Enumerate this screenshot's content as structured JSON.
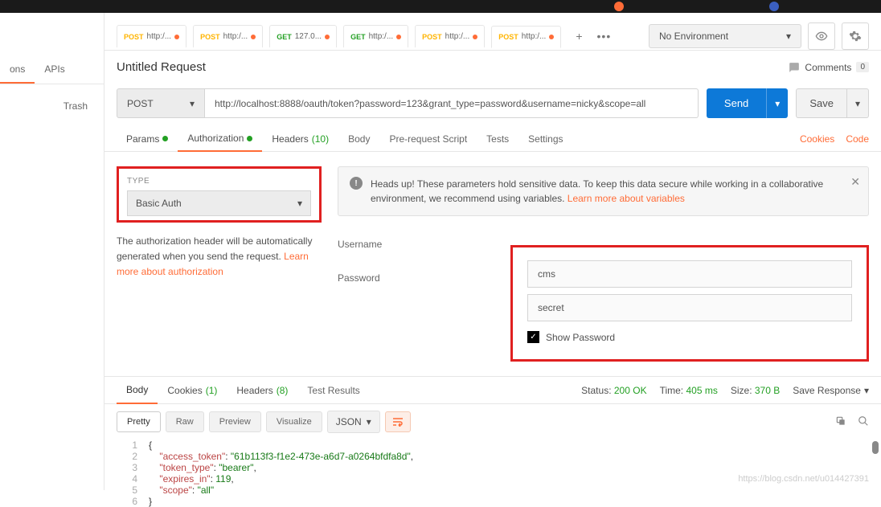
{
  "sidebar": {
    "tab1": "ons",
    "tab2": "APIs",
    "trash": "Trash"
  },
  "tabs": [
    {
      "method": "POST",
      "url": "http:/..."
    },
    {
      "method": "POST",
      "url": "http:/..."
    },
    {
      "method": "GET",
      "url": "127.0..."
    },
    {
      "method": "GET",
      "url": "http:/..."
    },
    {
      "method": "POST",
      "url": "http:/..."
    },
    {
      "method": "POST",
      "url": "http:/..."
    }
  ],
  "env": {
    "label": "No Environment"
  },
  "request": {
    "title": "Untitled Request",
    "comments": "Comments",
    "comments_count": "0",
    "method": "POST",
    "url": "http://localhost:8888/oauth/token?password=123&grant_type=password&username=nicky&scope=all",
    "send": "Send",
    "save": "Save"
  },
  "reqtabs": {
    "params": "Params",
    "auth": "Authorization",
    "headers": "Headers",
    "headers_cnt": "(10)",
    "body": "Body",
    "prereq": "Pre-request Script",
    "tests": "Tests",
    "settings": "Settings",
    "cookies": "Cookies",
    "code": "Code"
  },
  "auth": {
    "type_label": "TYPE",
    "type": "Basic Auth",
    "desc1": "The authorization header will be automatically generated when you send the request. ",
    "desc_link": "Learn more about authorization",
    "alert": "Heads up! These parameters hold sensitive data. To keep this data secure while working in a collaborative environment, we recommend using variables. ",
    "alert_link": "Learn more about variables",
    "username_lbl": "Username",
    "password_lbl": "Password",
    "username": "cms",
    "password": "secret",
    "show": "Show Password"
  },
  "resp": {
    "body": "Body",
    "cookies": "Cookies",
    "cookies_cnt": "(1)",
    "headers": "Headers",
    "headers_cnt": "(8)",
    "tests": "Test Results",
    "status_l": "Status:",
    "status": "200 OK",
    "time_l": "Time:",
    "time": "405 ms",
    "size_l": "Size:",
    "size": "370 B",
    "save": "Save Response",
    "pretty": "Pretty",
    "raw": "Raw",
    "preview": "Preview",
    "visualize": "Visualize",
    "lang": "JSON"
  },
  "json": {
    "l1": "{",
    "k1": "\"access_token\"",
    "v1": "\"61b113f3-f1e2-473e-a6d7-a0264bfdfa8d\"",
    "k2": "\"token_type\"",
    "v2": "\"bearer\"",
    "k3": "\"expires_in\"",
    "v3": "119",
    "k4": "\"scope\"",
    "v4": "\"all\"",
    "l6": "}"
  },
  "watermark": "https://blog.csdn.net/u014427391"
}
